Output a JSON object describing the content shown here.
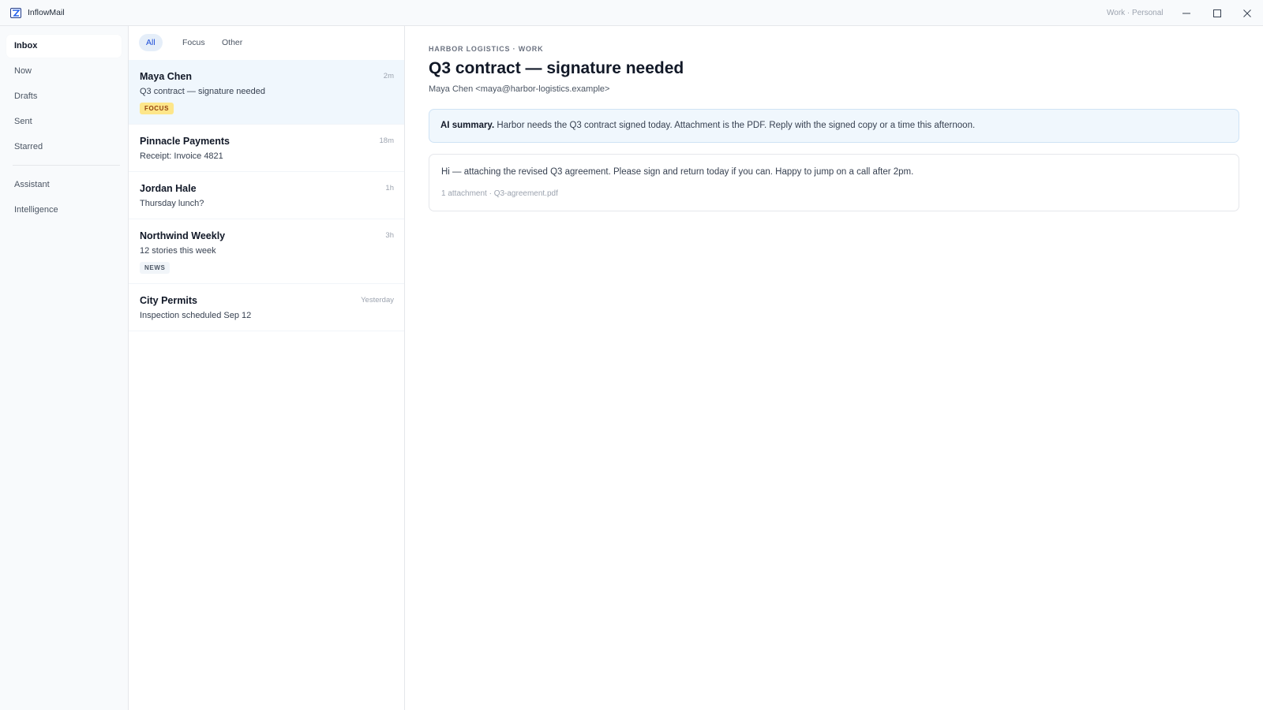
{
  "app": {
    "title": "InflowMail",
    "account_switch": "Work · Personal",
    "colors": {
      "accent": "#1d4ed8",
      "selected_row": "#f0f7fd",
      "focus_tag": "#fde68a"
    }
  },
  "window": {
    "minimize_icon": "minimize-icon",
    "maximize_icon": "maximize-icon",
    "close_icon": "close-icon"
  },
  "sidebar": {
    "items": [
      {
        "label": "Inbox"
      },
      {
        "label": "Now"
      },
      {
        "label": "Drafts"
      },
      {
        "label": "Sent"
      },
      {
        "label": "Starred"
      }
    ],
    "secondary_items": [
      {
        "label": "Assistant"
      },
      {
        "label": "Intelligence"
      }
    ]
  },
  "list": {
    "tabs": [
      {
        "label": "All"
      },
      {
        "label": "Focus"
      },
      {
        "label": "Other"
      }
    ],
    "messages": [
      {
        "sender": "Maya Chen",
        "subject": "Q3 contract — signature needed",
        "time": "2m",
        "tag": "FOCUS"
      },
      {
        "sender": "Pinnacle Payments",
        "subject": "Receipt: Invoice 4821",
        "time": "18m"
      },
      {
        "sender": "Jordan Hale",
        "subject": "Thursday lunch?",
        "time": "1h"
      },
      {
        "sender": "Northwind Weekly",
        "subject": "12 stories this week",
        "time": "3h",
        "tag": "NEWS"
      },
      {
        "sender": "City Permits",
        "subject": "Inspection scheduled Sep 12",
        "time": "Yesterday"
      }
    ]
  },
  "reading": {
    "kicker": "HARBOR LOGISTICS · WORK",
    "subject": "Q3 contract — signature needed",
    "from": "Maya Chen <maya@harbor-logistics.example>",
    "summary_label": "AI summary.",
    "summary_text": " Harbor needs the Q3 contract signed today. Attachment is the PDF. Reply with the signed copy or a time this afternoon.",
    "body": "Hi — attaching the revised Q3 agreement. Please sign and return today if you can. Happy to jump on a call after 2pm.",
    "attachment_count": "1 attachment · ",
    "attachment_name": "Q3-agreement.pdf"
  }
}
